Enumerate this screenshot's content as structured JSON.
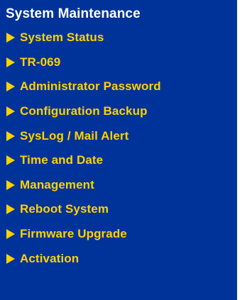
{
  "menu": {
    "title": "System Maintenance",
    "arrow_icon": "triangle-right-icon",
    "colors": {
      "background": "#003399",
      "title": "#ffffff",
      "item": "#ffd200"
    },
    "items": [
      {
        "label": "System Status"
      },
      {
        "label": "TR-069"
      },
      {
        "label": "Administrator Password"
      },
      {
        "label": "Configuration Backup"
      },
      {
        "label": "SysLog / Mail Alert"
      },
      {
        "label": "Time and Date"
      },
      {
        "label": "Management"
      },
      {
        "label": "Reboot System"
      },
      {
        "label": "Firmware Upgrade"
      },
      {
        "label": "Activation"
      }
    ]
  }
}
